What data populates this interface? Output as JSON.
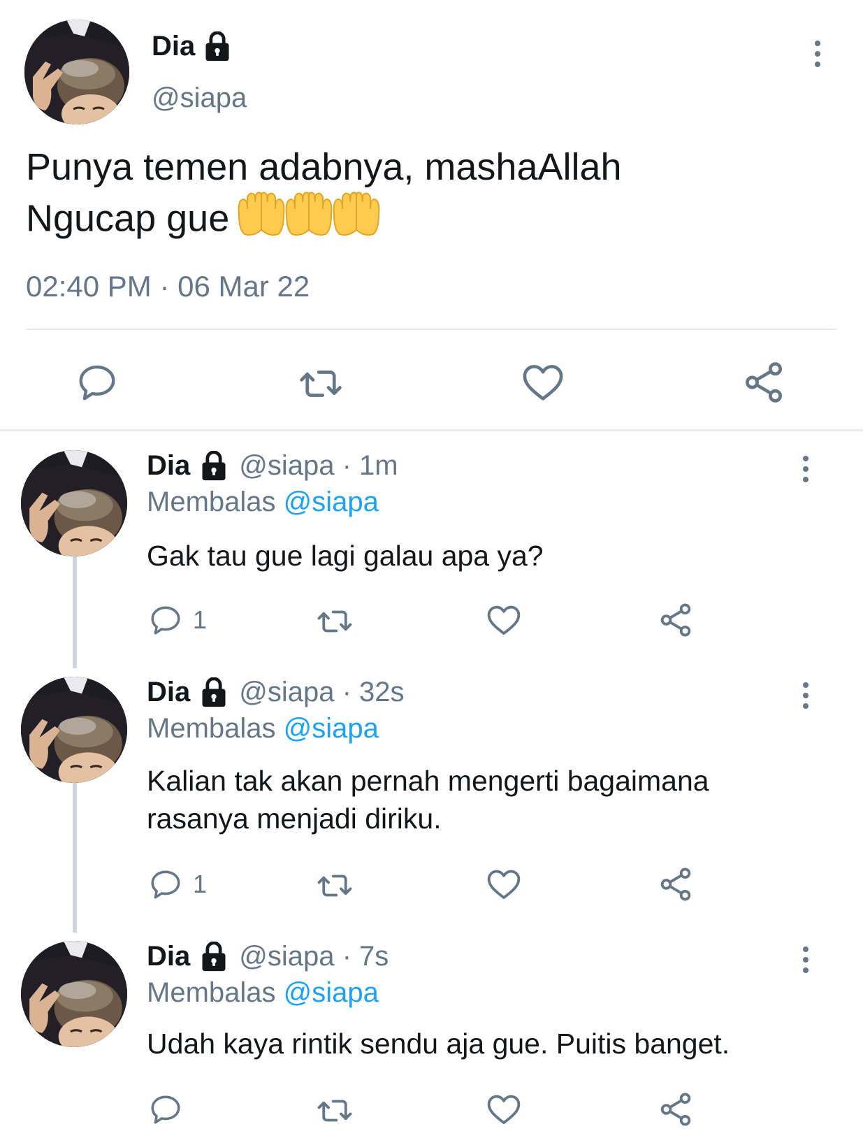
{
  "main_tweet": {
    "name": "Dia",
    "handle": "@siapa",
    "text_line1": "Punya temen adabnya, mashaAllah",
    "text_line2": "Ngucap gue",
    "emoji": "🤲🤲🤲",
    "timestamp": "02:40 PM · 06 Mar 22",
    "actions": {
      "reply_icon": "reply-icon",
      "retweet_icon": "retweet-icon",
      "like_icon": "heart-icon",
      "share_icon": "share-icon"
    }
  },
  "replies": [
    {
      "name": "Dia",
      "handle": "@siapa · 1m",
      "replying_prefix": "Membalas",
      "replying_to": "@siapa",
      "text": "Gak tau gue lagi galau apa ya?",
      "reply_count": "1"
    },
    {
      "name": "Dia",
      "handle": "@siapa · 32s",
      "replying_prefix": "Membalas",
      "replying_to": "@siapa",
      "text": "Kalian tak akan pernah mengerti bagaimana rasanya menjadi diriku.",
      "reply_count": "1"
    },
    {
      "name": "Dia",
      "handle": "@siapa · 7s",
      "replying_prefix": "Membalas",
      "replying_to": "@siapa",
      "text": "Udah kaya rintik sendu aja gue. Puitis banget.",
      "reply_count": ""
    }
  ],
  "colors": {
    "text": "#14171a",
    "secondary": "#657786",
    "accent": "#1da1f2",
    "divider": "#e6ecf0"
  }
}
